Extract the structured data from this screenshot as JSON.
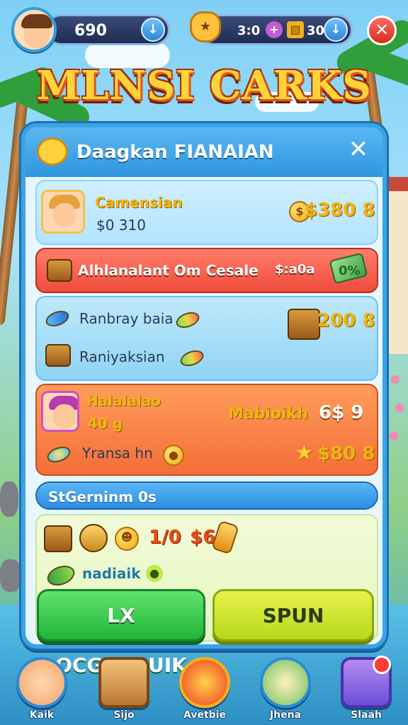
{
  "header": {
    "score": "690",
    "score_button_icon": "down-arrow-icon",
    "currency_1": "3:0",
    "currency_1_icon": "plus-icon",
    "currency_2": "308",
    "currency_2_icon": "gold-bars-icon",
    "close_icon": "close-icon"
  },
  "title": "MLNSI CARKS",
  "panel": {
    "heading": "Daagkan FIANAIAN",
    "close_icon": "close-icon",
    "row_a": {
      "name": "Camensian",
      "price": "$0 310",
      "reward": "$380 8"
    },
    "row_b": {
      "label": "Alhlanalant Om Cesale",
      "price": "$:a0a",
      "badge": "0%"
    },
    "row_c": {
      "item_1": "Ranbray baia",
      "item_2": "Raniyaksian",
      "reward": "200 8"
    },
    "row_d": {
      "name": "Halalalao",
      "price": "40 g",
      "offer": "Mabioikh",
      "offer_value": "6$ 9",
      "item": "Yransa hn",
      "reward": "$80 8"
    },
    "row_e": {
      "label": "StGerninm 0s"
    },
    "row_f": {
      "count": "1/0",
      "count_value": "$6",
      "label": "nadiaik"
    },
    "buttons": {
      "left": "LX OCGTKDUIK",
      "right": "SPUN"
    }
  },
  "nav": [
    {
      "label": "Kaik",
      "icon": "avatar-icon"
    },
    {
      "label": "Sijo",
      "icon": "chest-icon"
    },
    {
      "label": "Avetbie",
      "icon": "fire-orb-icon"
    },
    {
      "label": "Jhena",
      "icon": "flower-shop-icon"
    },
    {
      "label": "Slaah",
      "icon": "tablet-icon"
    }
  ],
  "colors": {
    "panel_border": "#3aa3e6",
    "accent_gold": "#f0b515",
    "button_green": "#22b43a",
    "button_lime": "#b6d91b",
    "close_red": "#d62d22"
  }
}
